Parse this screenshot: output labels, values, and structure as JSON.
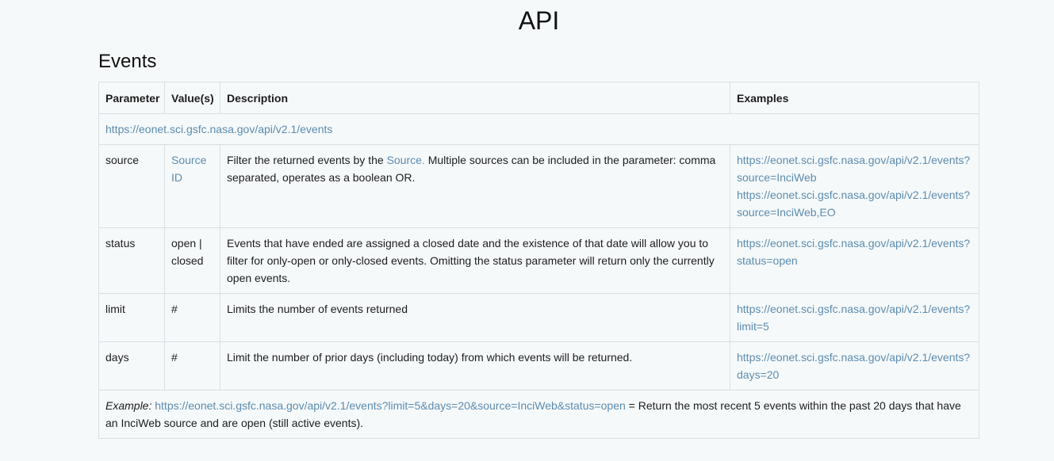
{
  "page_title": "API",
  "section_title": "Events",
  "table": {
    "headers": [
      "Parameter",
      "Value(s)",
      "Description",
      "Examples"
    ],
    "base_url": "https://eonet.sci.gsfc.nasa.gov/api/v2.1/events",
    "rows": [
      {
        "parameter": "source",
        "value_link": "Source ID",
        "description_before": "Filter the returned events by the ",
        "description_link": "Source.",
        "description_after": " Multiple sources can be included in the parameter: comma separated, operates as a boolean OR.",
        "examples": [
          "https://eonet.sci.gsfc.nasa.gov/api/v2.1/events?source=InciWeb",
          "https://eonet.sci.gsfc.nasa.gov/api/v2.1/events?source=InciWeb,EO"
        ]
      },
      {
        "parameter": "status",
        "value": "open | closed",
        "description": "Events that have ended are assigned a closed date and the existence of that date will allow you to filter for only-open or only-closed events. Omitting the status parameter will return only the currently open events.",
        "examples": [
          "https://eonet.sci.gsfc.nasa.gov/api/v2.1/events?status=open"
        ]
      },
      {
        "parameter": "limit",
        "value": "#",
        "description": "Limits the number of events returned",
        "examples": [
          "https://eonet.sci.gsfc.nasa.gov/api/v2.1/events?limit=5"
        ]
      },
      {
        "parameter": "days",
        "value": "#",
        "description": "Limit the number of prior days (including today) from which events will be returned.",
        "examples": [
          "https://eonet.sci.gsfc.nasa.gov/api/v2.1/events?days=20"
        ]
      }
    ],
    "example": {
      "label": "Example:",
      "url": "https://eonet.sci.gsfc.nasa.gov/api/v2.1/events?limit=5&days=20&source=InciWeb&status=open",
      "text": " = Return the most recent 5 events within the past 20 days that have an InciWeb source and are open (still active events)."
    }
  },
  "colors": {
    "background": "#f6f9fa",
    "link": "#5b8cb0",
    "border": "#d8dfe3"
  }
}
